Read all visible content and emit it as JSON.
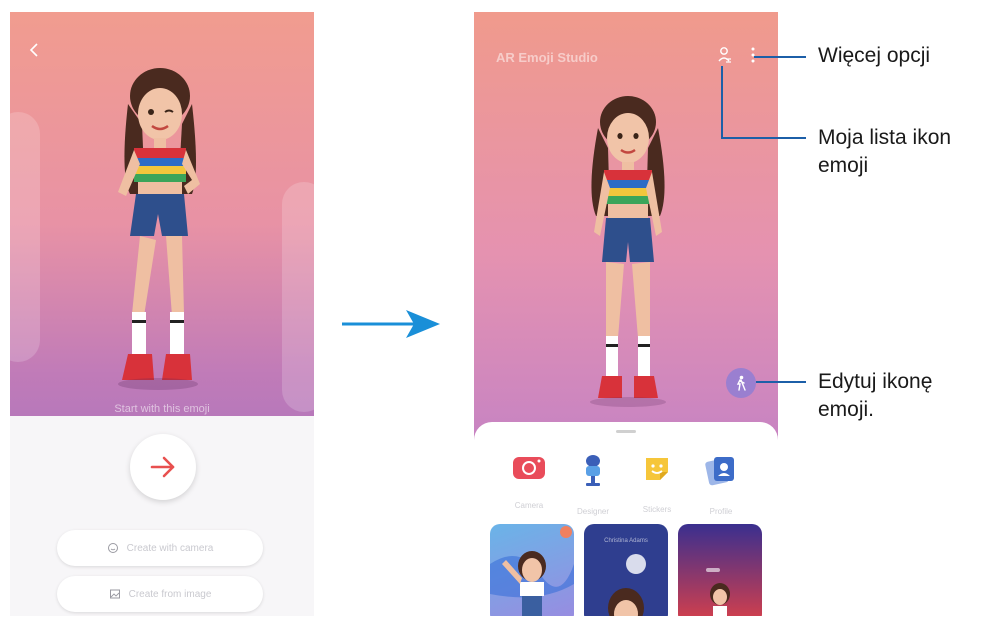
{
  "left_screen": {
    "start_text": "Start with this emoji",
    "create_with_camera": "Create with camera",
    "create_from_image": "Create from image"
  },
  "right_screen": {
    "title": "AR Emoji Studio",
    "actions": [
      {
        "label": "Camera",
        "icon": "camera-icon"
      },
      {
        "label": "Designer",
        "icon": "designer-icon"
      },
      {
        "label": "Stickers",
        "icon": "sticker-icon"
      },
      {
        "label": "Profile",
        "icon": "profile-icon"
      }
    ],
    "preview_name": "Christina Adams"
  },
  "callouts": {
    "more_options": "Więcej opcji",
    "my_emoji_list_line1": "Moja lista ikon",
    "my_emoji_list_line2": "emoji",
    "edit_emoji_line1": "Edytuj ikonę",
    "edit_emoji_line2": "emoji."
  },
  "colors": {
    "callout_line": "#1c5fa8",
    "flow_arrow": "#1a8fd8",
    "cta_arrow": "#e8504f"
  }
}
